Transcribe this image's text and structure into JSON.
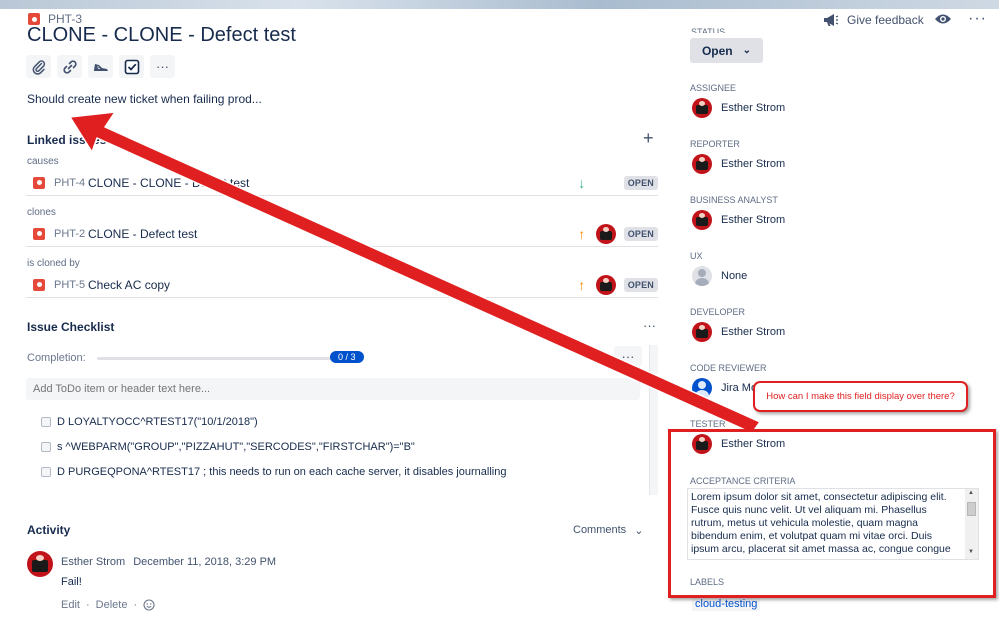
{
  "issue": {
    "key": "PHT-3",
    "title": "CLONE - CLONE - Defect test",
    "description": "Should create new ticket when failing prod..."
  },
  "toolbar": {
    "icons": [
      "attachment-icon",
      "link-icon",
      "shoe-icon",
      "checklist-icon",
      "more-icon"
    ],
    "more_label": "···"
  },
  "linked_issues": {
    "title": "Linked issues",
    "add_label": "+",
    "groups": [
      {
        "relation": "causes",
        "key": "PHT-4",
        "summary": "CLONE - CLONE - Defect test",
        "priority": "↓",
        "status": "OPEN"
      },
      {
        "relation": "clones",
        "key": "PHT-2",
        "summary": "CLONE - Defect test",
        "priority": "↑",
        "status": "OPEN"
      },
      {
        "relation": "is cloned by",
        "key": "PHT-5",
        "summary": "Check AC copy",
        "priority": "↑",
        "status": "OPEN"
      }
    ]
  },
  "checklist": {
    "title": "Issue Checklist",
    "menu_label": "···",
    "completion_label": "Completion:",
    "progress": "0 / 3",
    "progress_fraction": 0,
    "add_placeholder": "Add ToDo item or header text here...",
    "items": [
      "D LOYALTYOCC^RTEST17(\"10/1/2018\")",
      "s ^WEBPARM(\"GROUP\",\"PIZZAHUT\",\"SERCODES\",\"FIRSTCHAR\")=\"B\"",
      "D PURGEQPONA^RTEST17 ; this needs to run on each cache server, it disables journalling"
    ]
  },
  "activity": {
    "title": "Activity",
    "filter": "Comments",
    "comment": {
      "author": "Esther Strom",
      "date": "December 11, 2018, 3:29 PM",
      "body": "Fail!",
      "edit": "Edit",
      "delete": "Delete",
      "sep": "·"
    }
  },
  "header_right": {
    "feedback": "Give feedback",
    "more": "···"
  },
  "fields": {
    "status_label": "STATUS",
    "status_value": "Open",
    "assignee": {
      "label": "ASSIGNEE",
      "value": "Esther Strom"
    },
    "reporter": {
      "label": "REPORTER",
      "value": "Esther Strom"
    },
    "business_analyst": {
      "label": "BUSINESS ANALYST",
      "value": "Esther Strom"
    },
    "ux": {
      "label": "UX",
      "value": "None"
    },
    "developer": {
      "label": "DEVELOPER",
      "value": "Esther Strom"
    },
    "code_reviewer": {
      "label": "CODE REVIEWER",
      "value": "Jira Mo"
    },
    "tester": {
      "label": "TESTER",
      "value": "Esther Strom"
    },
    "acceptance_criteria": {
      "label": "ACCEPTANCE CRITERIA",
      "value": "Lorem ipsum dolor sit amet, consectetur adipiscing elit. Fusce quis nunc velit. Ut vel aliquam mi. Phasellus rutrum, metus ut vehicula molestie, quam magna bibendum enim, et volutpat quam mi vitae orci. Duis ipsum arcu, placerat sit amet massa ac, congue congue"
    },
    "labels": {
      "label": "LABELS",
      "value": "cloud-testing"
    }
  },
  "annotation": {
    "callout": "How can I make this field display over there?",
    "color": "#e02020"
  },
  "colors": {
    "accent": "#0052cc",
    "bug": "#e5493a",
    "priority_low": "#36b37e",
    "priority_high": "#ff8b00"
  }
}
